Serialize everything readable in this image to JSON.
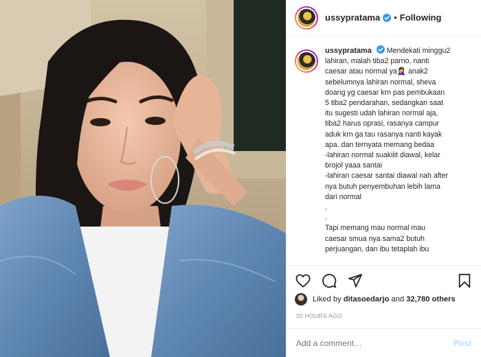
{
  "colors": {
    "verified_blue": "#3897f0",
    "text": "#262626",
    "muted": "#8e8e8e",
    "post_button_disabled": "#b2dffc",
    "border": "#efefef"
  },
  "photo": {
    "description_icon": "selfie-photo"
  },
  "header": {
    "username": "ussypratama",
    "separator": "•",
    "follow_label": "Following"
  },
  "caption": {
    "username": "ussypratama",
    "lines": [
      "Mendekati minggu2",
      "lahiran, malah tiba2 parno, nanti",
      "caesar atau normal ya🤦‍♀️ anak2",
      "sebelumnya lahiran normal, sheva",
      "doang yg caesar krn pas pembukaan",
      "5 tiba2 pendarahan, sedangkan saat",
      "itu sugesti udah lahiran normal aja,",
      "tiba2 harus oprasi, rasanya campur",
      "aduk krn ga tau rasanya nanti kayak",
      "apa..dan ternyata memang bedaa",
      "-lahiran normal suakiiit diawal, kelar",
      "brojol yaaa santai",
      "-lahiran caesar santai diawal nah after",
      "nya butuh penyembuhan lebih lama",
      "dari normal",
      ".",
      ".",
      "Tapi memang mau normal mau",
      "caesar smua nya sama2 butuh",
      "perjuangan, dan ibu tetaplah ibu"
    ]
  },
  "actions": {
    "like_icon": "heart-icon",
    "comment_icon": "comment-icon",
    "share_icon": "share-icon",
    "save_icon": "bookmark-icon"
  },
  "likes": {
    "prefix": "Liked by",
    "user": "ditasoedarjo",
    "conjunction": "and",
    "count": "32,780 others"
  },
  "timestamp": "20 HOURS AGO",
  "comment": {
    "placeholder": "Add a comment…",
    "post_label": "Post"
  }
}
